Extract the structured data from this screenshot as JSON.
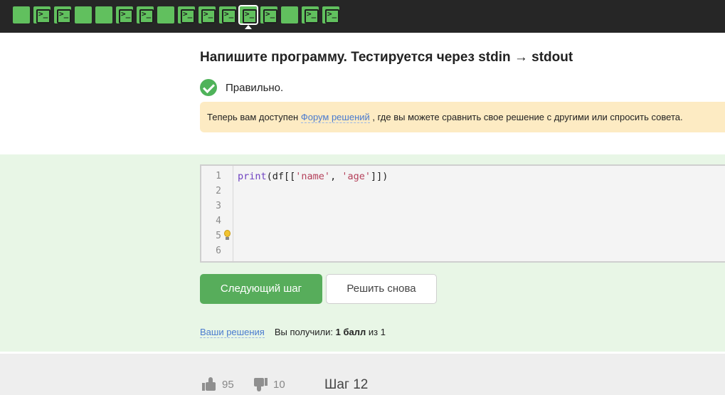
{
  "step_bar": {
    "steps": [
      {
        "type": "text"
      },
      {
        "type": "code"
      },
      {
        "type": "code"
      },
      {
        "type": "text"
      },
      {
        "type": "text"
      },
      {
        "type": "code"
      },
      {
        "type": "code"
      },
      {
        "type": "text"
      },
      {
        "type": "code"
      },
      {
        "type": "code"
      },
      {
        "type": "code"
      },
      {
        "type": "code",
        "current": true
      },
      {
        "type": "code"
      },
      {
        "type": "text"
      },
      {
        "type": "code"
      },
      {
        "type": "code"
      }
    ],
    "code_glyph": ">_",
    "passed_color": "#61c05e"
  },
  "task": {
    "title": "Напишите программу. Тестируется через stdin → stdout",
    "status_icon": "check-circle-icon",
    "status_text": "Правильно.",
    "notice_before": "Теперь вам доступен ",
    "notice_link": "Форум решений",
    "notice_after": " , где вы можете сравнить свое решение с другими или спросить совета."
  },
  "editor": {
    "line_numbers": [
      "1",
      "2",
      "3",
      "4",
      "5",
      "6"
    ],
    "code": {
      "func": "print",
      "open": "(df[[",
      "arg1": "'name'",
      "sep": ", ",
      "arg2": "'age'",
      "close": "]])"
    },
    "hint_icon": "lightbulb-icon"
  },
  "actions": {
    "next_label": "Следующий шаг",
    "retry_label": "Решить снова"
  },
  "result": {
    "solutions_link": "Ваши решения",
    "score_prefix": "Вы получили: ",
    "score_value": "1 балл",
    "score_suffix": " из 1"
  },
  "footer": {
    "likes": "95",
    "dislikes": "10",
    "step_label": "Шаг 12"
  }
}
